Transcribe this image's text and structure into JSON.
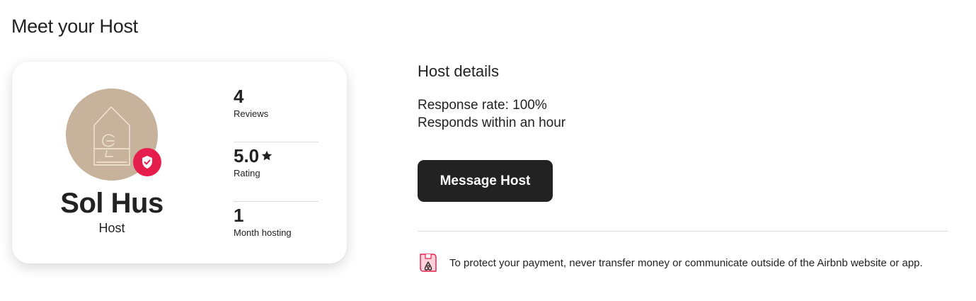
{
  "section": {
    "title": "Meet your Host"
  },
  "host": {
    "name": "Sol Hus",
    "role": "Host",
    "verified": true,
    "badge_color": "#e61e4d",
    "avatar_bg": "#c7b29b",
    "avatar_icon": "house-sketch-icon"
  },
  "stats": [
    {
      "value": "4",
      "label": "Reviews"
    },
    {
      "value": "5.0",
      "label": "Rating",
      "icon": "star-icon"
    },
    {
      "value": "1",
      "label": "Month hosting"
    }
  ],
  "details": {
    "heading": "Host details",
    "response_rate": "Response rate: 100%",
    "response_time": "Responds within an hour"
  },
  "actions": {
    "message_label": "Message Host"
  },
  "notice": {
    "icon": "airbnb-shield-icon",
    "text": "To protect your payment, never transfer money or communicate outside of the Airbnb website or app."
  }
}
